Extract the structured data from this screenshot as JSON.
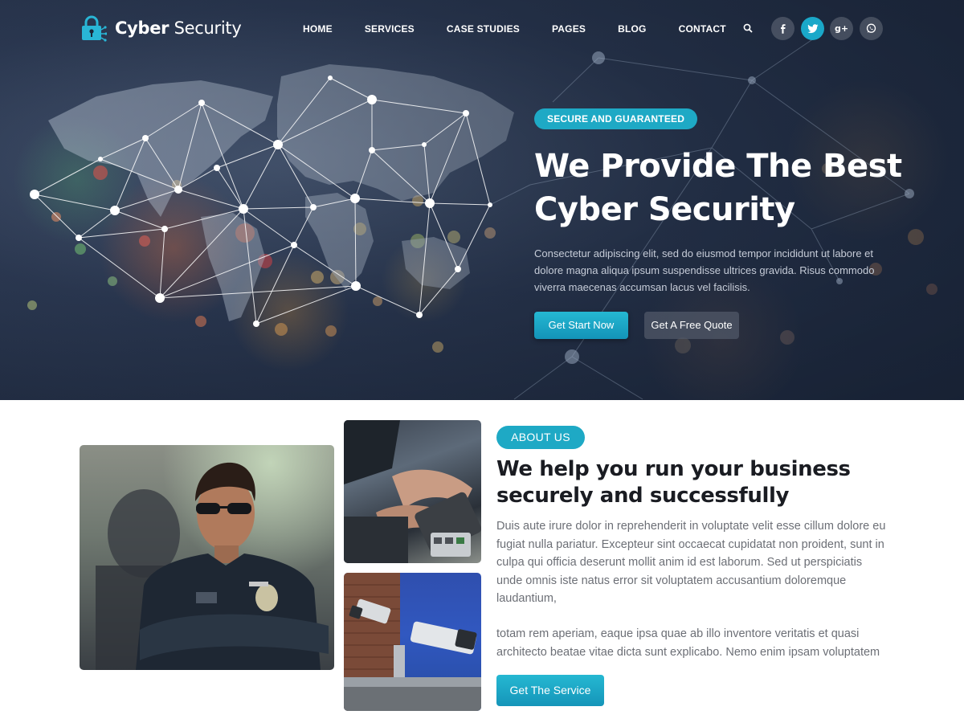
{
  "brand": {
    "name_bold": "Cyber",
    "name_light": " Security",
    "logo_icon": "lock-network-icon"
  },
  "nav": {
    "items": [
      {
        "label": "HOME"
      },
      {
        "label": "SERVICES"
      },
      {
        "label": "CASE STUDIES"
      },
      {
        "label": "PAGES"
      },
      {
        "label": "BLOG"
      },
      {
        "label": "CONTACT"
      }
    ],
    "search_icon": "search-icon"
  },
  "social": [
    {
      "glyph": "f",
      "icon": "facebook-icon",
      "active": false
    },
    {
      "glyph": "t",
      "icon": "twitter-icon",
      "active": true
    },
    {
      "glyph": "g+",
      "icon": "google-plus-icon",
      "active": false
    },
    {
      "glyph": "w",
      "icon": "whatsapp-icon",
      "active": false
    }
  ],
  "hero": {
    "badge": "SECURE AND GUARANTEED",
    "title_line1": "We Provide The Best",
    "title_line2": "Cyber Security",
    "description": "Consectetur adipiscing elit, sed do eiusmod tempor incididunt ut labore et dolore magna aliqua ipsum suspendisse ultrices gravida. Risus commodo viverra maecenas accumsan lacus vel facilisis.",
    "primary_button": "Get Start Now",
    "secondary_button": "Get A Free Quote"
  },
  "about": {
    "badge": "ABOUT US",
    "title": "We help you run your business securely and successfully",
    "paragraph1": "Duis aute irure dolor in reprehenderit in voluptate velit esse cillum dolore eu fugiat nulla pariatur. Excepteur sint occaecat cupidatat non proident, sunt in culpa qui  officia deserunt mollit anim id est laborum. Sed ut perspiciatis unde omnis iste natus error sit voluptatem accusantium doloremque laudantium,",
    "paragraph2": "totam rem aperiam, eaque ipsa quae ab illo inventore veritatis et quasi architecto beatae vitae dicta sunt explicabo. Nemo enim ipsam voluptatem",
    "button": "Get The Service"
  },
  "colors": {
    "accent": "#1ea9c5",
    "hero_dark": "#1b2538",
    "heading": "#1a1c22",
    "body_text": "#6c6f76"
  }
}
